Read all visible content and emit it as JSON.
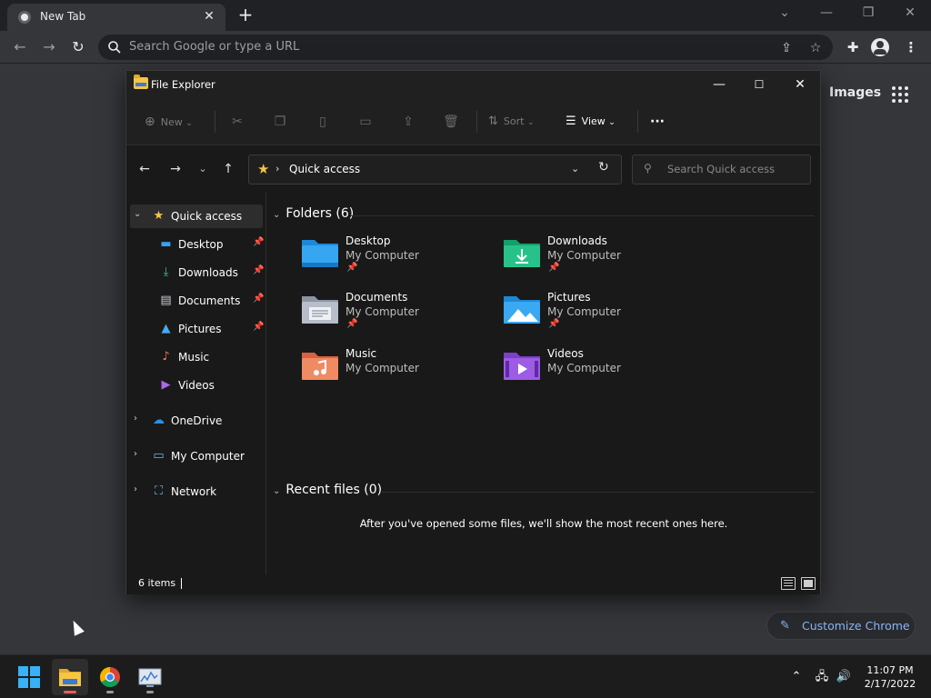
{
  "browser": {
    "tab_title": "New Tab",
    "omnibox_placeholder": "Search Google or type a URL",
    "images_link": "Images",
    "customize_label": "Customize Chrome"
  },
  "explorer": {
    "window_title": "File Explorer",
    "commands": {
      "new": "New",
      "sort": "Sort",
      "view": "View",
      "more": "···"
    },
    "address": "Quick access",
    "search_placeholder": "Search Quick access",
    "sidebar": [
      {
        "label": "Quick access",
        "icon": "star-icon"
      },
      {
        "label": "Desktop",
        "icon": "desktop-icon"
      },
      {
        "label": "Downloads",
        "icon": "download-icon"
      },
      {
        "label": "Documents",
        "icon": "document-icon"
      },
      {
        "label": "Pictures",
        "icon": "pictures-icon"
      },
      {
        "label": "Music",
        "icon": "music-icon"
      },
      {
        "label": "Videos",
        "icon": "videos-icon"
      },
      {
        "label": "OneDrive",
        "icon": "cloud-icon"
      },
      {
        "label": "My Computer",
        "icon": "computer-icon"
      },
      {
        "label": "Network",
        "icon": "network-icon"
      }
    ],
    "folders_header": "Folders (6)",
    "folders": [
      {
        "name": "Desktop",
        "location": "My Computer"
      },
      {
        "name": "Downloads",
        "location": "My Computer"
      },
      {
        "name": "Documents",
        "location": "My Computer"
      },
      {
        "name": "Pictures",
        "location": "My Computer"
      },
      {
        "name": "Music",
        "location": "My Computer"
      },
      {
        "name": "Videos",
        "location": "My Computer"
      }
    ],
    "recent_header": "Recent files (0)",
    "recent_empty": "After you've opened some files, we'll show the most recent ones here.",
    "status_count": "6 items"
  },
  "taskbar": {
    "time": "11:07 PM",
    "date": "2/17/2022"
  },
  "colors": {
    "accent_blue": "#8ab4f8",
    "folder_yellow": "#f6c543"
  }
}
